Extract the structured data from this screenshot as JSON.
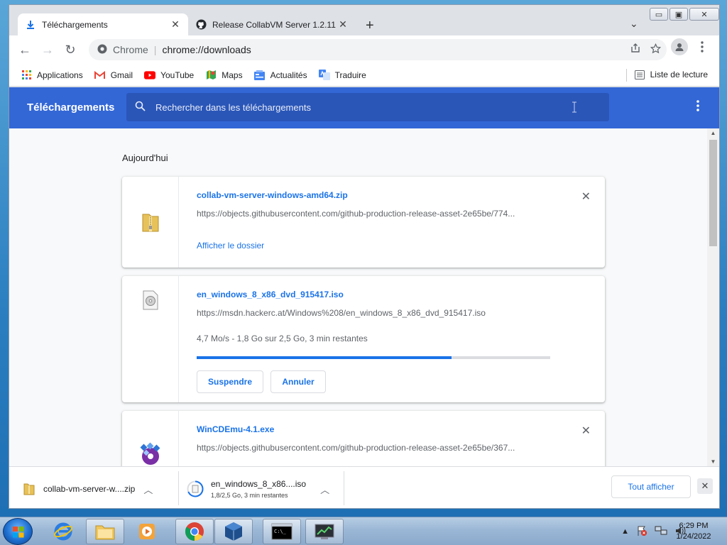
{
  "window": {
    "controls": {
      "minimize": "▭",
      "maximize": "▣",
      "close": "✕"
    }
  },
  "tabs": [
    {
      "label": "Téléchargements",
      "close": "✕"
    },
    {
      "label": "Release CollabVM Server 1.2.11 ·",
      "close": "✕"
    }
  ],
  "toolbar": {
    "new_tab": "+",
    "tab_search": "⌄",
    "back": "←",
    "forward": "→",
    "reload": "↻",
    "site_chip": "Chrome",
    "separator": "|",
    "url": "chrome://downloads"
  },
  "bookmarks": {
    "items": [
      {
        "label": "Applications",
        "icon": "apps-grid-icon"
      },
      {
        "label": "Gmail",
        "icon": "gmail-icon"
      },
      {
        "label": "YouTube",
        "icon": "youtube-icon"
      },
      {
        "label": "Maps",
        "icon": "maps-icon"
      },
      {
        "label": "Actualités",
        "icon": "news-icon"
      },
      {
        "label": "Traduire",
        "icon": "translate-icon"
      }
    ],
    "reading_list": "Liste de lecture"
  },
  "downloads_page": {
    "title": "Téléchargements",
    "search_placeholder": "Rechercher dans les téléchargements",
    "day_label": "Aujourd'hui",
    "items": [
      {
        "name": "collab-vm-server-windows-amd64.zip",
        "source": "https://objects.githubusercontent.com/github-production-release-asset-2e65be/774...",
        "link": "Afficher le dossier"
      },
      {
        "name": "en_windows_8_x86_dvd_915417.iso",
        "source": "https://msdn.hackerc.at/Windows%208/en_windows_8_x86_dvd_915417.iso",
        "status": "4,7 Mo/s - 1,8 Go sur 2,5 Go, 3 min restantes",
        "progress": 0.72,
        "pause": "Suspendre",
        "cancel": "Annuler"
      },
      {
        "name": "WinCDEmu-4.1.exe",
        "source": "https://objects.githubusercontent.com/github-production-release-asset-2e65be/367..."
      }
    ]
  },
  "shelf": {
    "items": [
      {
        "name": "collab-vm-server-w....zip"
      },
      {
        "name": "en_windows_8_x86....iso",
        "status": "1,8/2,5 Go, 3 min restantes"
      }
    ],
    "show_all": "Tout afficher",
    "close": "✕"
  },
  "taskbar": {
    "time": "6:29 PM",
    "date": "1/24/2022"
  },
  "colors": {
    "accent": "#3367d6",
    "link": "#1a73e8"
  }
}
